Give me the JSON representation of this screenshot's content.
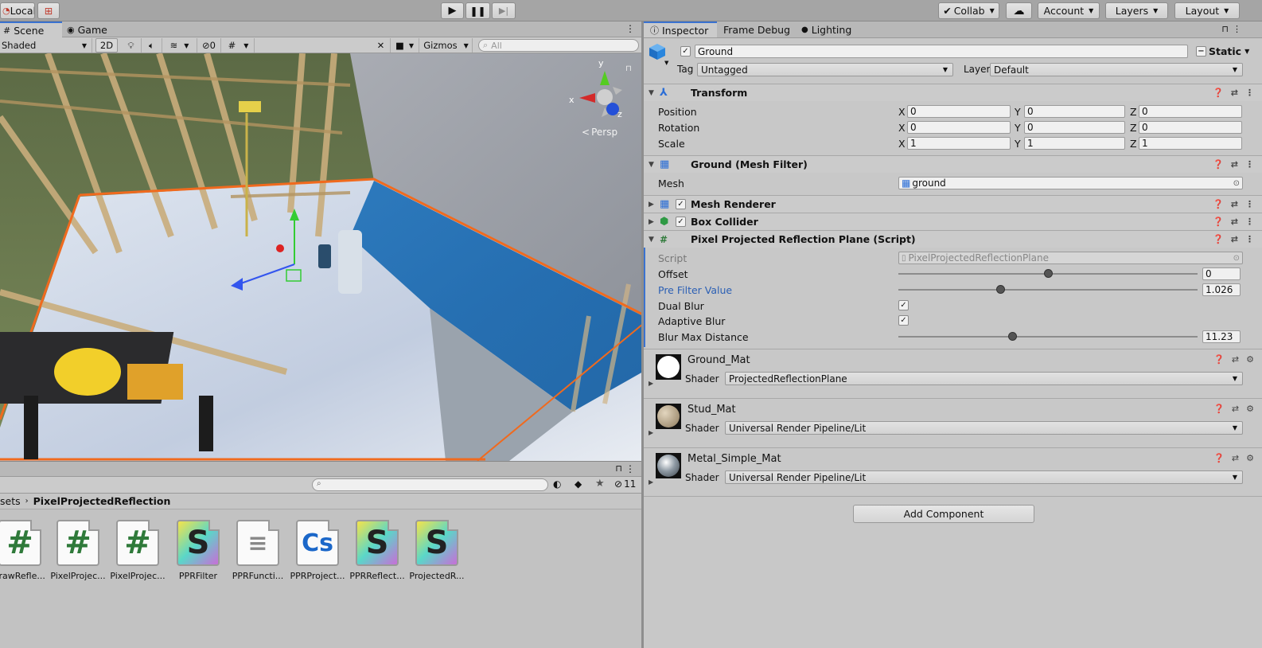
{
  "toolbar": {
    "local_label": "Local",
    "collab_label": "Collab",
    "account_label": "Account",
    "layers_label": "Layers",
    "layout_label": "Layout"
  },
  "scene": {
    "tabs": [
      "Scene",
      "Game"
    ],
    "shading_mode": "Shaded",
    "mode_2d": "2D",
    "hidden_count": "0",
    "gizmos_label": "Gizmos",
    "search_placeholder": "All",
    "persp_label": "Persp",
    "axis_labels": {
      "x": "x",
      "y": "y",
      "z": "z"
    }
  },
  "project": {
    "hidden_count": "11",
    "breadcrumb": [
      "sets",
      "PixelProjectedReflection"
    ],
    "assets": [
      {
        "label": "DrawRefle...",
        "icon": "#",
        "kind": "script-icon",
        "color": "#2f7a3a"
      },
      {
        "label": "PixelProjec...",
        "icon": "#",
        "kind": "script-icon",
        "color": "#2f7a3a"
      },
      {
        "label": "PixelProjec...",
        "icon": "#",
        "kind": "script-icon",
        "color": "#2f7a3a"
      },
      {
        "label": "PPRFilter",
        "icon": "S",
        "kind": "shader-icon",
        "color": "#222222"
      },
      {
        "label": "PPRFuncti...",
        "icon": "≡",
        "kind": "text-file-icon",
        "color": "#888888"
      },
      {
        "label": "PPRProject...",
        "icon": "Cs",
        "kind": "csharp-icon",
        "color": "#1b67c9"
      },
      {
        "label": "PPRReflect...",
        "icon": "S",
        "kind": "shader-icon",
        "color": "#222222"
      },
      {
        "label": "ProjectedR...",
        "icon": "S",
        "kind": "shader-icon",
        "color": "#222222"
      }
    ]
  },
  "inspector": {
    "tabs": [
      "Inspector",
      "Frame Debug",
      "Lighting"
    ],
    "object_name": "Ground",
    "static_label": "Static",
    "tag_label": "Tag",
    "tag_value": "Untagged",
    "layer_label": "Layer",
    "layer_value": "Default",
    "transform": {
      "title": "Transform",
      "rows": [
        {
          "label": "Position",
          "x": "0",
          "y": "0",
          "z": "0"
        },
        {
          "label": "Rotation",
          "x": "0",
          "y": "0",
          "z": "0"
        },
        {
          "label": "Scale",
          "x": "1",
          "y": "1",
          "z": "1"
        }
      ],
      "axis": {
        "x": "X",
        "y": "Y",
        "z": "Z"
      }
    },
    "mesh_filter": {
      "title": "Ground (Mesh Filter)",
      "mesh_label": "Mesh",
      "mesh_value": "ground"
    },
    "mesh_renderer": {
      "title": "Mesh Renderer"
    },
    "box_collider": {
      "title": "Box Collider"
    },
    "script": {
      "title": "Pixel Projected Reflection Plane (Script)",
      "script_label": "Script",
      "script_value": "PixelProjectedReflectionPlane",
      "offset_label": "Offset",
      "offset_value": "0",
      "offset_fraction": 0.5,
      "prefilter_label": "Pre Filter Value",
      "prefilter_value": "1.026",
      "prefilter_fraction": 0.34,
      "dual_blur_label": "Dual Blur",
      "dual_blur": true,
      "adaptive_blur_label": "Adaptive Blur",
      "adaptive_blur": true,
      "blur_max_label": "Blur Max Distance",
      "blur_max_value": "11.23",
      "blur_max_fraction": 0.38
    },
    "materials": [
      {
        "name": "Ground_Mat",
        "shader_label": "Shader",
        "shader": "ProjectedReflectionPlane"
      },
      {
        "name": "Stud_Mat",
        "shader_label": "Shader",
        "shader": "Universal Render Pipeline/Lit"
      },
      {
        "name": "Metal_Simple_Mat",
        "shader_label": "Shader",
        "shader": "Universal Render Pipeline/Lit"
      }
    ],
    "add_component_label": "Add Component"
  },
  "colors": {
    "accent_blue": "#3a72d0",
    "selection_orange": "#f06a1e",
    "prefab_label_blue": "#2b5fb4"
  }
}
